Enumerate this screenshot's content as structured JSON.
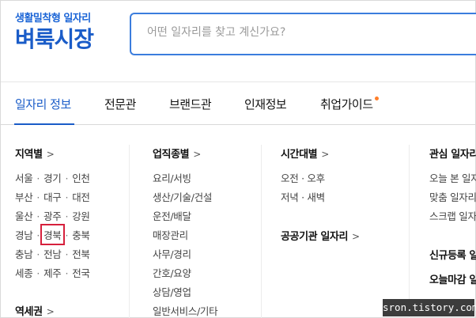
{
  "logo": {
    "subtitle": "생활밀착형 일자리",
    "title": "벼룩시장"
  },
  "search": {
    "placeholder": "어떤 일자리를 찾고 계신가요?"
  },
  "nav": {
    "tabs": [
      {
        "label": "일자리 정보",
        "active": true
      },
      {
        "label": "전문관"
      },
      {
        "label": "브랜드관"
      },
      {
        "label": "인재정보"
      },
      {
        "label": "취업가이드",
        "dot": true
      }
    ]
  },
  "col1": {
    "title": "지역별",
    "rows": [
      [
        "서울",
        "경기",
        "인천"
      ],
      [
        "부산",
        "대구",
        "대전"
      ],
      [
        "울산",
        "광주",
        "강원"
      ],
      [
        "경남",
        "경북",
        "충북"
      ],
      [
        "충남",
        "전남",
        "전북"
      ],
      [
        "세종",
        "제주",
        "전국"
      ]
    ],
    "title2": "역세권"
  },
  "col2": {
    "title": "업직종별",
    "items": [
      "요리/서빙",
      "생산/기술/건설",
      "운전/배달",
      "매장관리",
      "사무/경리",
      "간호/요양",
      "상담/영업",
      "일반서비스/기타"
    ]
  },
  "col3": {
    "title": "시간대별",
    "items": [
      "오전 · 오후",
      "저녁 · 새벽"
    ],
    "title2": "공공기관 일자리"
  },
  "col4": {
    "title": "관심 일자리",
    "items": [
      "오늘 본 일자리",
      "맞춤 일자리",
      "스크랩 일자리"
    ],
    "title2": "신규등록 일자리",
    "title3": "오늘마감 일자리"
  },
  "watermark": "sron.tistory.com",
  "colors": {
    "brand": "#1a5cc8",
    "highlight": "#d6203c",
    "dot": "#ff7f2a"
  }
}
